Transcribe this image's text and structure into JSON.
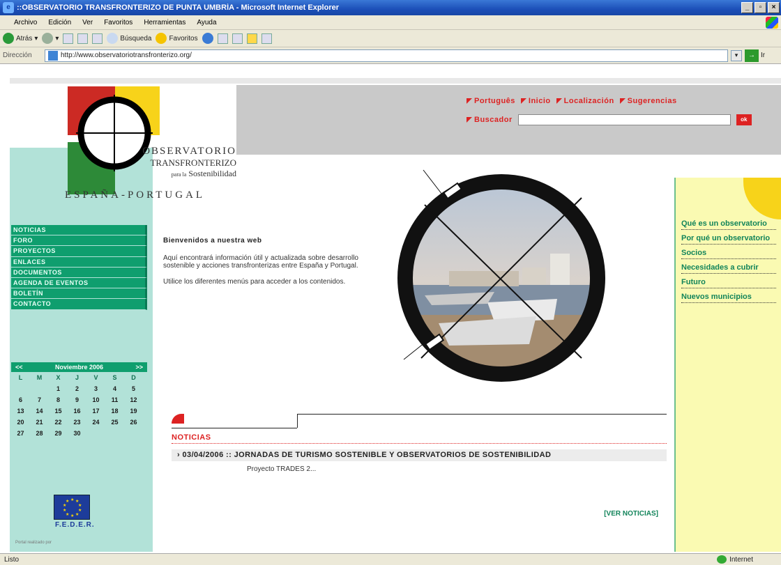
{
  "window": {
    "title": "::OBSERVATORIO TRANSFRONTERIZO DE PUNTA UMBRÍA - Microsoft Internet Explorer",
    "min": "_",
    "max": "▫",
    "close": "×"
  },
  "menu": [
    "Archivo",
    "Edición",
    "Ver",
    "Favoritos",
    "Herramientas",
    "Ayuda"
  ],
  "toolbar": {
    "back": "Atrás",
    "search": "Búsqueda",
    "favorites": "Favoritos"
  },
  "address": {
    "label": "Dirección",
    "url": "http://www.observatoriotransfronterizo.org/",
    "go": "Ir"
  },
  "status": {
    "left": "Listo",
    "zone": "Internet"
  },
  "header": {
    "links": [
      "Português",
      "Inicio",
      "Localización",
      "Sugerencias"
    ],
    "search_label": "Buscador",
    "search_value": "",
    "search_button": "ok"
  },
  "logo": {
    "line1": "OBSERVATORIO",
    "line2": "TRANSFRONTERIZO",
    "line3_small": "para la",
    "line3": "Sostenibilidad",
    "line4": "ESPAÑA-PORTUGAL"
  },
  "nav": [
    "NOTICIAS",
    "FORO",
    "PROYECTOS",
    "ENLACES",
    "DOCUMENTOS",
    "AGENDA DE EVENTOS",
    "BOLETÍN",
    "CONTACTO"
  ],
  "calendar": {
    "prev": "<<",
    "month": "Noviembre 2006",
    "next": ">>",
    "dow": [
      "L",
      "M",
      "X",
      "J",
      "V",
      "S",
      "D"
    ],
    "days": [
      "",
      "",
      "1",
      "2",
      "3",
      "4",
      "5",
      "6",
      "7",
      "8",
      "9",
      "10",
      "11",
      "12",
      "13",
      "14",
      "15",
      "16",
      "17",
      "18",
      "19",
      "20",
      "21",
      "22",
      "23",
      "24",
      "25",
      "26",
      "27",
      "28",
      "29",
      "30",
      "",
      "",
      ""
    ]
  },
  "eu": {
    "label": "F.E.D.E.R.",
    "credit": "Portal realizado por"
  },
  "welcome": {
    "title": "Bienvenidos a nuestra web",
    "p1": "Aquí encontrará información útil y actualizada sobre desarrollo sostenible y acciones transfronterizas entre España y Portugal.",
    "p2": "Utilice los diferentes menús para acceder a los contenidos."
  },
  "right_links": [
    "Qué es un observatorio",
    "Por qué un observatorio",
    "Socios",
    "Necesidades a cubrir",
    "Futuro",
    "Nuevos municipios"
  ],
  "news": {
    "title": "NOTICIAS",
    "item": "03/04/2006 :: JORNADAS DE TURISMO SOSTENIBLE Y OBSERVATORIOS DE SOSTENIBILIDAD",
    "sub": "Proyecto TRADES 2...",
    "more": "[VER NOTICIAS]"
  },
  "colors": {
    "teal": "#0f9e6e",
    "red": "#d22222",
    "yellow": "#f7d31a",
    "green": "#2d8a38"
  }
}
